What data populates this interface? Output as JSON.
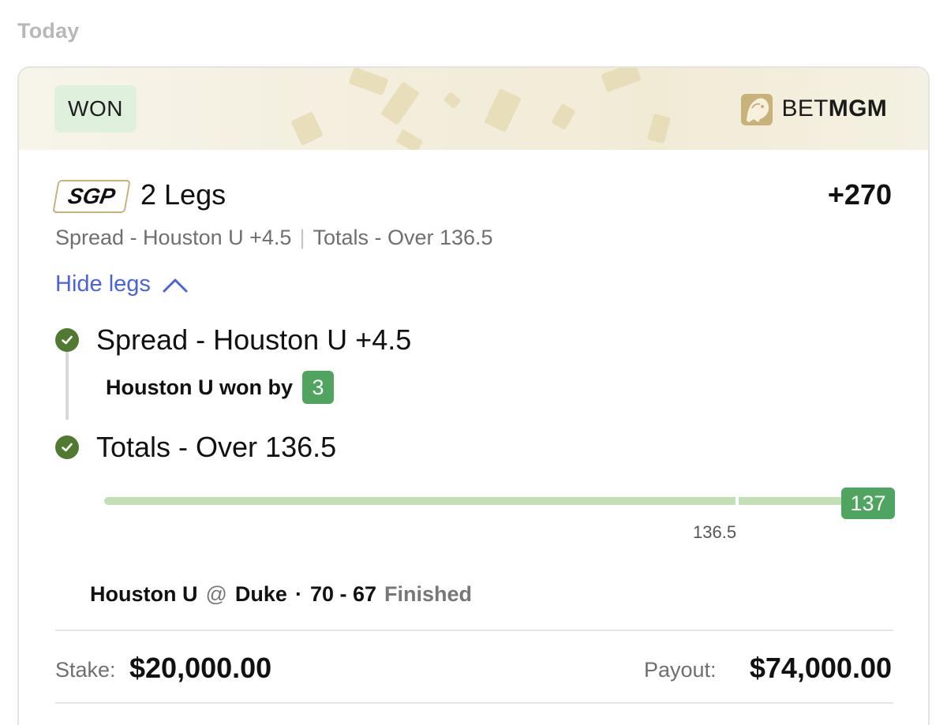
{
  "section_label": "Today",
  "bet": {
    "status": "WON",
    "brand": {
      "prefix": "BET",
      "suffix": "MGM"
    },
    "type_badge": "SGP",
    "legs_title": "2 Legs",
    "odds": "+270",
    "summary_left": "Spread - Houston U +4.5",
    "summary_sep": "|",
    "summary_right": "Totals - Over 136.5",
    "toggle_label": "Hide legs",
    "legs": [
      {
        "title": "Spread - Houston U +4.5",
        "result_text": "Houston U won by",
        "result_value": "3",
        "status": "won"
      },
      {
        "title": "Totals - Over 136.5",
        "status": "won",
        "progress": {
          "current": "137",
          "threshold": "136.5"
        }
      }
    ],
    "game": {
      "away": "Houston U",
      "at": "@",
      "home": "Duke",
      "dot": "·",
      "score": "70 - 67",
      "status": "Finished"
    },
    "stake_label": "Stake:",
    "stake_value": "$20,000.00",
    "payout_label": "Payout:",
    "payout_value": "$74,000.00"
  },
  "colors": {
    "won_pill": "#dff0dc",
    "check_green": "#4f7a2f",
    "badge_green": "#4fa55f",
    "progress_track": "#c3dfb6",
    "link_blue": "#4a63d6",
    "brand_gold": "#c8b27a"
  },
  "icons": [
    "check-circle-icon",
    "chevron-up-icon",
    "lion-logo-icon"
  ]
}
